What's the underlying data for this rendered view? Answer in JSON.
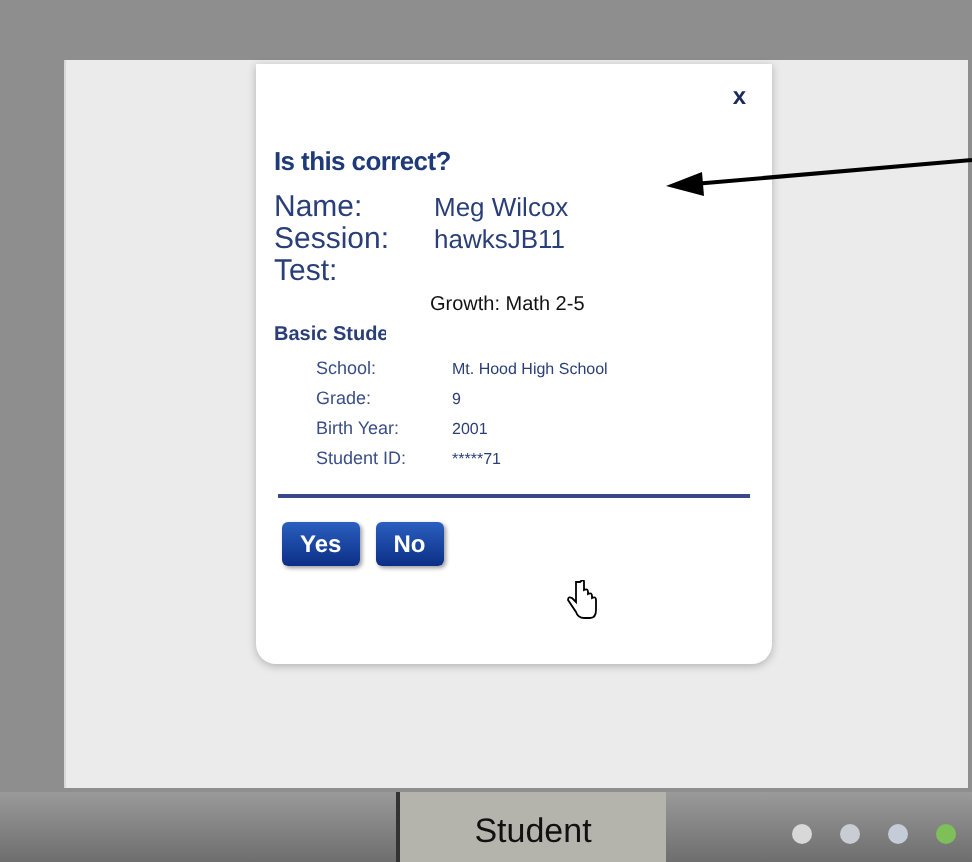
{
  "dialog": {
    "close": "x",
    "title": "Is this correct?",
    "fields": [
      {
        "label": "Name:",
        "value": "Meg Wilcox"
      },
      {
        "label": "Session:",
        "value": "hawksJB11"
      },
      {
        "label": "Test:"
      }
    ],
    "section": "Basic Stude",
    "details": [
      {
        "label": "School:",
        "value": "Mt. Hood High School"
      },
      {
        "label": "Grade:",
        "value": "9"
      },
      {
        "label": "Birth Year:",
        "value": "2001"
      },
      {
        "label": "Student ID:",
        "value": "*****71"
      }
    ],
    "buttons": [
      "Yes",
      "No"
    ]
  },
  "callout": {
    "text": "Growth:  Math 2-5"
  },
  "taskbar": {
    "label": "Student",
    "indicators": [
      {
        "color": "#d8d8d8"
      },
      {
        "color": "#c8ccd4"
      },
      {
        "color": "#c4ccd8"
      },
      {
        "color": "#7fbf5a"
      }
    ]
  }
}
